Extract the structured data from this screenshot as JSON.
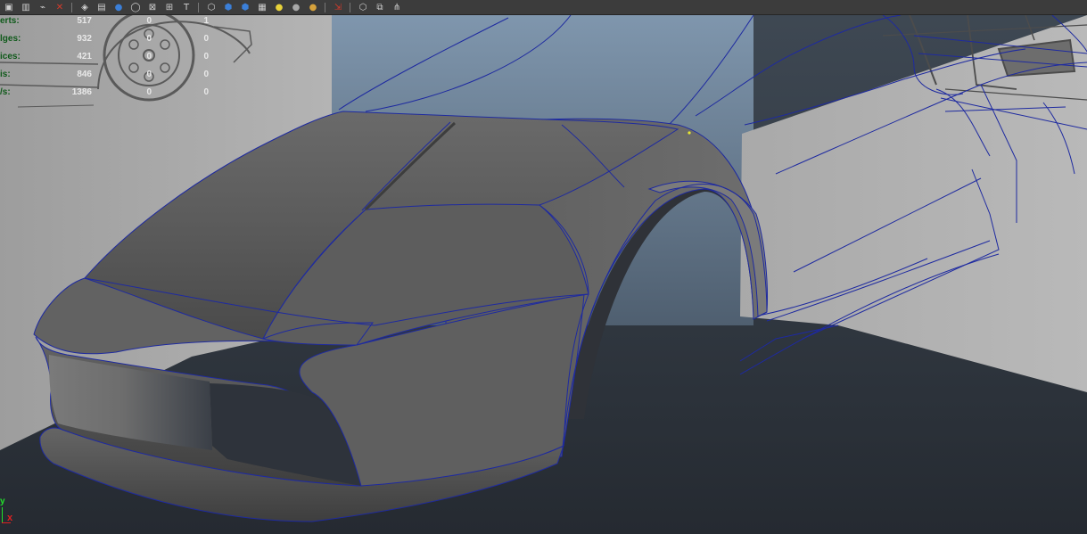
{
  "toolbar": {
    "buttons": [
      {
        "name": "render-region-icon",
        "glyph": "▣"
      },
      {
        "name": "render-settings-icon",
        "glyph": "▥"
      },
      {
        "name": "snap-curve-icon",
        "glyph": "⌁"
      },
      {
        "name": "delete-history-icon",
        "glyph": "✕"
      },
      {
        "name": "separator"
      },
      {
        "name": "layer-icon",
        "glyph": "◈"
      },
      {
        "name": "film-icon",
        "glyph": "▤"
      },
      {
        "name": "sphere-icon",
        "glyph": "●"
      },
      {
        "name": "circle-icon",
        "glyph": "◯"
      },
      {
        "name": "x-ray-icon",
        "glyph": "⊠"
      },
      {
        "name": "uv-icon",
        "glyph": "⊞"
      },
      {
        "name": "text-icon",
        "glyph": "T"
      },
      {
        "name": "separator"
      },
      {
        "name": "wireframe-cube-icon",
        "glyph": "⬡"
      },
      {
        "name": "smooth-cube-icon",
        "glyph": "⬢"
      },
      {
        "name": "textured-cube-icon",
        "glyph": "⬢"
      },
      {
        "name": "checker-icon",
        "glyph": "▦"
      },
      {
        "name": "light-yellow-icon",
        "glyph": "●"
      },
      {
        "name": "light-grey-icon",
        "glyph": "●"
      },
      {
        "name": "light-gold-icon",
        "glyph": "●"
      },
      {
        "name": "separator"
      },
      {
        "name": "select-tool-icon",
        "glyph": "⇲"
      },
      {
        "name": "separator"
      },
      {
        "name": "isolate-icon",
        "glyph": "⬡"
      },
      {
        "name": "frame-icon",
        "glyph": "⧉"
      },
      {
        "name": "share-icon",
        "glyph": "⋔"
      }
    ],
    "colors": {
      "light_yellow": "#e8d23a",
      "light_grey": "#a8a8a8",
      "light_gold": "#d6a23c",
      "select_red": "#d83a2a",
      "blue": "#3b7fd8"
    }
  },
  "hud": {
    "rows": [
      {
        "label": "erts:",
        "v1": "517",
        "v2": "0",
        "v3": "1"
      },
      {
        "label": "lges:",
        "v1": "932",
        "v2": "0",
        "v3": "0"
      },
      {
        "label": "ices:",
        "v1": "421",
        "v2": "0",
        "v3": "0"
      },
      {
        "label": "is:",
        "v1": "846",
        "v2": "0",
        "v3": "0"
      },
      {
        "label": "/s:",
        "v1": "1386",
        "v2": "0",
        "v3": "0"
      }
    ]
  },
  "axis": {
    "y_label": "y",
    "x_label": "x"
  },
  "colors": {
    "viewport_bg": "#2b3038",
    "wire": "#1e2aa0",
    "body": "#5a5a5a",
    "hud_label": "#0f5a1a",
    "hud_value": "#e8e8e8"
  }
}
